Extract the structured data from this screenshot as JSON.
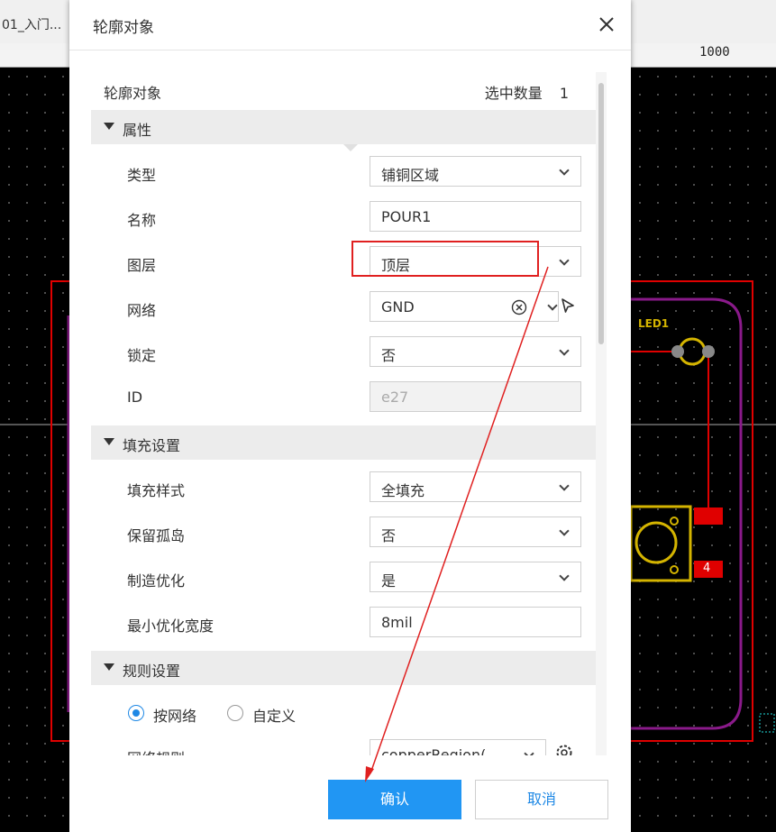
{
  "background": {
    "tab_label": "01_入门...",
    "ruler_label": "1000",
    "component_label": "LED1",
    "pad_number": "4"
  },
  "dialog": {
    "title": "轮廓对象",
    "object_title": "轮廓对象",
    "selected_count_label": "选中数量",
    "selected_count": "1"
  },
  "sections": {
    "properties": "属性",
    "fill_settings": "填充设置",
    "rule_settings": "规则设置"
  },
  "properties": {
    "type": {
      "label": "类型",
      "value": "铺铜区域"
    },
    "name": {
      "label": "名称",
      "value": "POUR1"
    },
    "layer": {
      "label": "图层",
      "value": "顶层"
    },
    "net": {
      "label": "网络",
      "value": "GND"
    },
    "lock": {
      "label": "锁定",
      "value": "否"
    },
    "id": {
      "label": "ID",
      "value": "e27"
    }
  },
  "fill": {
    "style": {
      "label": "填充样式",
      "value": "全填充"
    },
    "keep_islands": {
      "label": "保留孤岛",
      "value": "否"
    },
    "optimize": {
      "label": "制造优化",
      "value": "是"
    },
    "min_width": {
      "label": "最小优化宽度",
      "value": "8mil"
    }
  },
  "rules": {
    "by_net_label": "按网络",
    "custom_label": "自定义",
    "by_net_selected": true,
    "net_rule_label": "网络规则",
    "net_rule_value": "copperRegion("
  },
  "buttons": {
    "confirm": "确认",
    "cancel": "取消"
  },
  "colors": {
    "accent": "#2196f3",
    "annotation": "#e02020",
    "pcb_outline": "#e00000",
    "pcb_silk": "#d4b400",
    "pcb_keepout": "#8a1a8a"
  }
}
